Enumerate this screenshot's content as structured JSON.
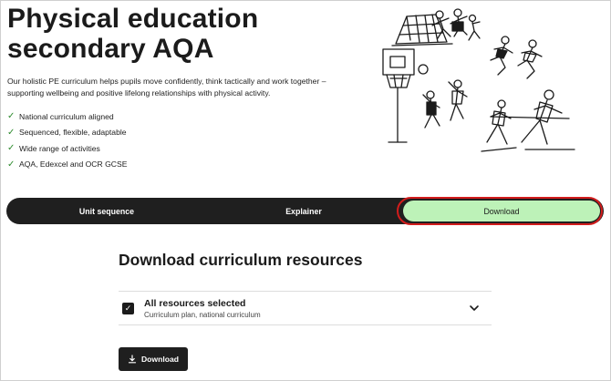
{
  "hero": {
    "title_line1": "Physical education",
    "title_line2": "secondary AQA",
    "intro": "Our holistic PE curriculum helps pupils move confidently, think tactically and work together – supporting wellbeing and positive lifelong relationships with physical activity.",
    "features": [
      "National curriculum aligned",
      "Sequenced, flexible, adaptable",
      "Wide range of activities",
      "AQA, Edexcel and OCR GCSE"
    ]
  },
  "tabs": {
    "unit_sequence": "Unit sequence",
    "explainer": "Explainer",
    "download": "Download"
  },
  "download_section": {
    "heading": "Download curriculum resources",
    "accordion_title": "All resources selected",
    "accordion_subtitle": "Curriculum plan, national curriculum",
    "button_label": "Download"
  },
  "colors": {
    "active_tab": "#bdf2b8",
    "tab_bar": "#1f1f1f",
    "highlight_ring": "#d21c1c",
    "check": "#2e8b2e"
  },
  "icons": [
    "check-icon",
    "chevron-down-icon",
    "download-icon",
    "checkbox-checked-icon"
  ]
}
